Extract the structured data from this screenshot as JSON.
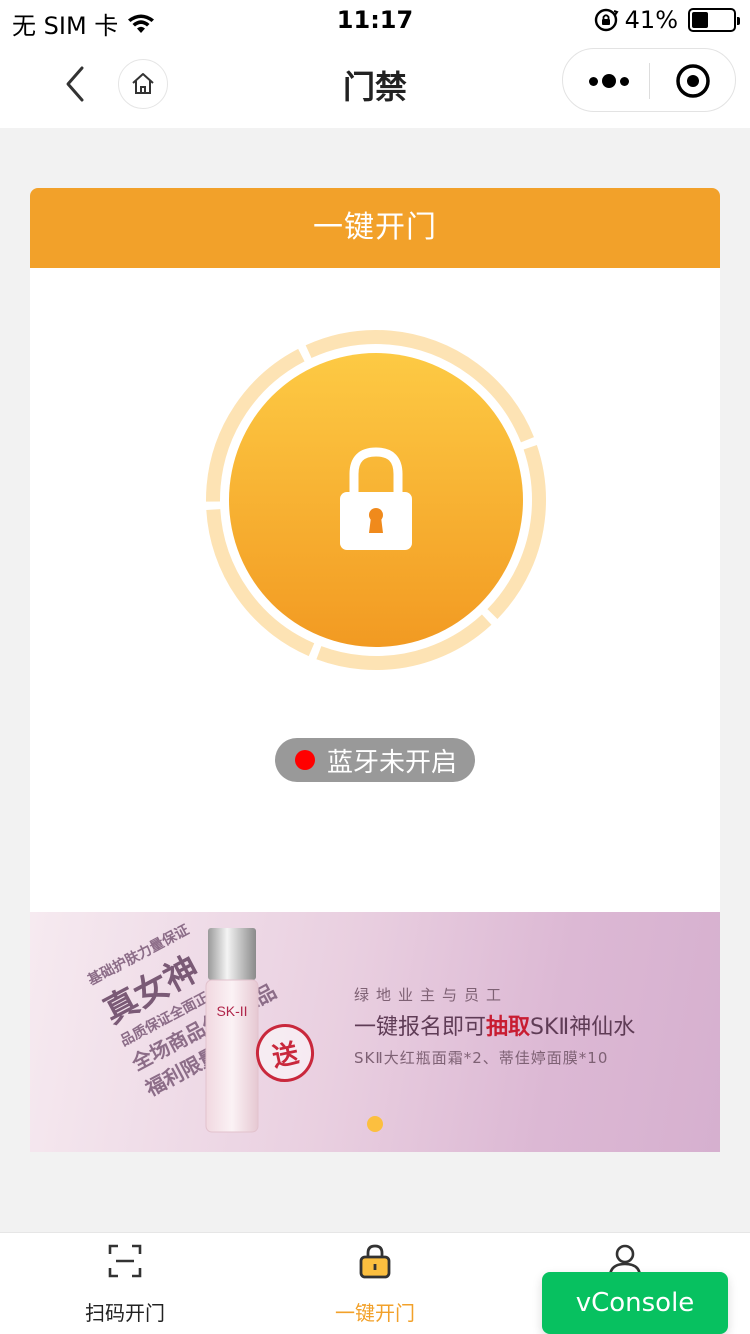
{
  "status_bar": {
    "carrier": "无 SIM 卡",
    "time": "11:17",
    "battery_percent": "41%",
    "battery_level": 0.41
  },
  "nav": {
    "title": "门禁",
    "back_icon": "chevron-left-icon",
    "home_icon": "home-icon",
    "more_icon": "more-dots-icon",
    "close_icon": "target-icon"
  },
  "card": {
    "header": "一键开门",
    "lock_icon": "lock-icon",
    "bluetooth_status": "蓝牙未开启",
    "accent_color": "#f2a12a"
  },
  "banner": {
    "slogan_lines": [
      "基础护肤力量保证",
      "真女神",
      "品质保证全面正品",
      "全场商品保证正品",
      "福利限量发送"
    ],
    "brand": "SK-II",
    "stamp": "送",
    "line1": "绿地业主与员工",
    "line2_before": "一键报名即可",
    "line2_highlight": "抽取",
    "line2_after": "SKⅡ神仙水",
    "line3": "SKⅡ大红瓶面霜*2、蒂佳婷面膜*10"
  },
  "tabs": [
    {
      "label": "扫码开门",
      "icon": "scan-icon",
      "active": false
    },
    {
      "label": "一键开门",
      "icon": "lock-icon",
      "active": true
    },
    {
      "label": "",
      "icon": "user-icon",
      "active": false
    }
  ],
  "vconsole": {
    "label": "vConsole",
    "color": "#07c160"
  }
}
